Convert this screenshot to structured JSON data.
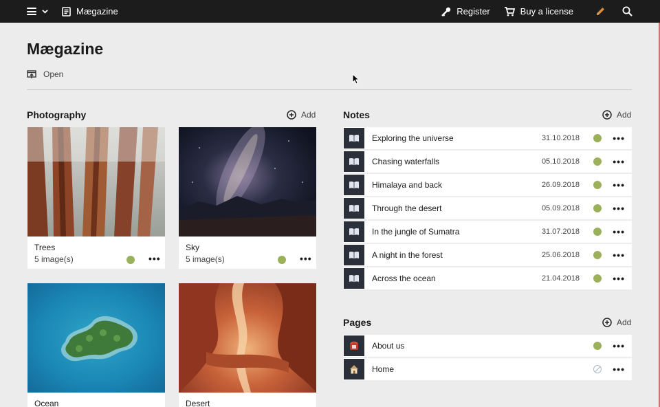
{
  "topbar": {
    "app_name": "Mægazine",
    "register_label": "Register",
    "license_label": "Buy a license",
    "icons": [
      "hamburger-icon",
      "chevron-down-icon",
      "document-icon",
      "key-icon",
      "cart-icon",
      "pencil-icon",
      "search-icon"
    ],
    "accent": "#e08a3c"
  },
  "header": {
    "title": "Mægazine",
    "open_label": "Open"
  },
  "photography": {
    "title": "Photography",
    "add_label": "Add",
    "cards": [
      {
        "title": "Trees",
        "subtitle": "5 image(s)",
        "status": "published"
      },
      {
        "title": "Sky",
        "subtitle": "5 image(s)",
        "status": "published"
      },
      {
        "title": "Ocean",
        "subtitle": "",
        "status": ""
      },
      {
        "title": "Desert",
        "subtitle": "",
        "status": ""
      }
    ]
  },
  "notes": {
    "title": "Notes",
    "add_label": "Add",
    "items": [
      {
        "label": "Exploring the universe",
        "date": "31.10.2018",
        "status": "published"
      },
      {
        "label": "Chasing waterfalls",
        "date": "05.10.2018",
        "status": "published"
      },
      {
        "label": "Himalaya and back",
        "date": "26.09.2018",
        "status": "published"
      },
      {
        "label": "Through the desert",
        "date": "05.09.2018",
        "status": "published"
      },
      {
        "label": "In the jungle of Sumatra",
        "date": "31.07.2018",
        "status": "published"
      },
      {
        "label": "A night in the forest",
        "date": "25.06.2018",
        "status": "published"
      },
      {
        "label": "Across the ocean",
        "date": "21.04.2018",
        "status": "published"
      }
    ]
  },
  "pages": {
    "title": "Pages",
    "add_label": "Add",
    "items": [
      {
        "label": "About us",
        "status": "published",
        "icon": "telephone-icon"
      },
      {
        "label": "Home",
        "status": "unpublished",
        "icon": "house-icon"
      }
    ]
  },
  "colors": {
    "published": "#9bb05a",
    "unpublished": "#a9b8cc",
    "topbar": "#1c1c1c"
  }
}
